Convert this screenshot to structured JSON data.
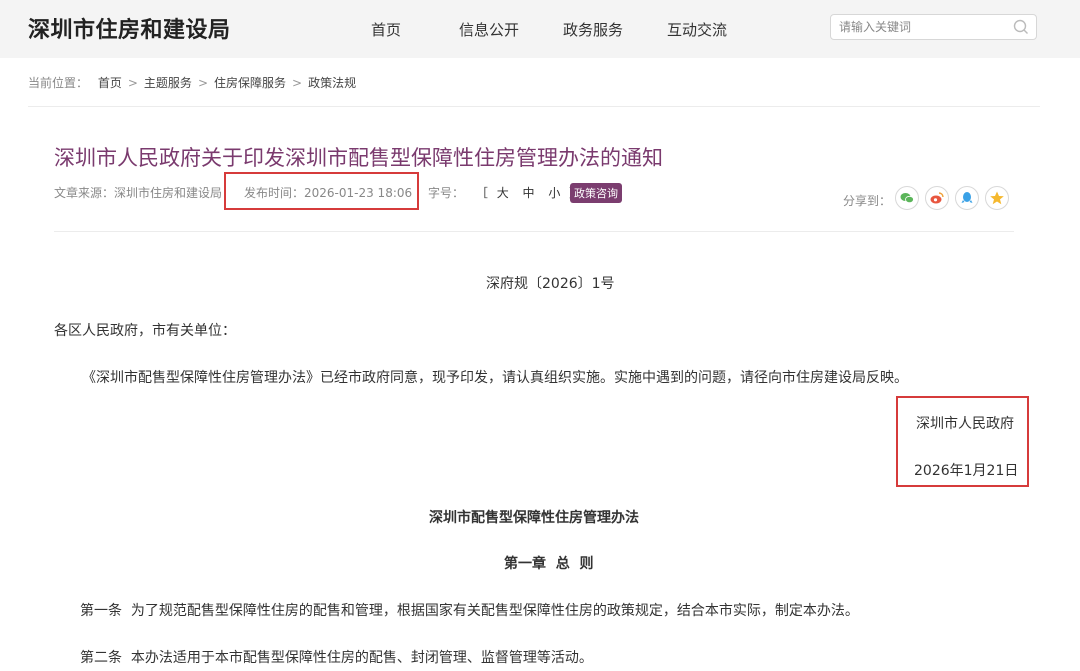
{
  "header": {
    "logo": "深圳市住房和建设局",
    "nav": [
      "首页",
      "信息公开",
      "政务服务",
      "互动交流"
    ],
    "search_placeholder": "请输入关键词"
  },
  "breadcrumb": {
    "label": "当前位置：",
    "items": [
      "首页",
      "主题服务",
      "住房保障服务",
      "政策法规"
    ]
  },
  "article": {
    "title": "深圳市人民政府关于印发深圳市配售型保障性住房管理办法的通知",
    "source": "文章来源：深圳市住房和建设局",
    "published": "发布时间：2026-01-23 18:06",
    "font_size_label": "字号：",
    "font_sizes": [
      "［",
      "大",
      "中",
      "小",
      "］"
    ],
    "tag": "政策咨询",
    "share_label": "分享到："
  },
  "body": {
    "doc_number": "深府规〔2026〕1号",
    "addressee": "各区人民政府，市有关单位：",
    "paragraph": "《深圳市配售型保障性住房管理办法》已经市政府同意，现予印发，请认真组织实施。实施中遇到的问题，请径向市住房建设局反映。",
    "issuer": "深圳市人民政府",
    "issue_date": "2026年1月21日",
    "heading": "深圳市配售型保障性住房管理办法",
    "chapter": "第一章  总  则",
    "article1": "第一条  为了规范配售型保障性住房的配售和管理，根据国家有关配售型保障性住房的政策规定，结合本市实际，制定本办法。",
    "article2": "第二条  本办法适用于本市配售型保障性住房的配售、封闭管理、监督管理等活动。"
  },
  "colors": {
    "title": "#7a3a6e",
    "tag_bg": "#7b3d6f",
    "highlight_border": "#d63b3b",
    "header_bg": "#f4f4f4"
  },
  "icons": [
    "search-icon",
    "wechat-icon",
    "weibo-icon",
    "qq-icon",
    "qzone-icon"
  ]
}
